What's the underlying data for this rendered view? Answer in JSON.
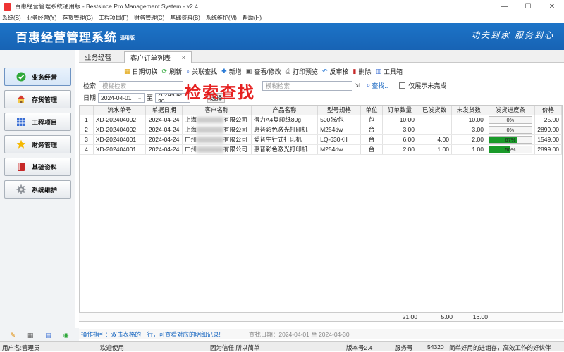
{
  "window": {
    "title": "百惠经营管理系统通用版 - Bestsince Pro Management System - v2.4",
    "min": "—",
    "max": "☐",
    "close": "✕"
  },
  "menu": [
    "系统(S)",
    "业务经营(Y)",
    "存货管理(G)",
    "工程项目(F)",
    "财务管理(C)",
    "基础资料(B)",
    "系统维护(M)",
    "帮助(H)"
  ],
  "banner": {
    "brand": "百惠经营管理系统",
    "edition": "通用版",
    "slogan": "功夫到家 服务到心"
  },
  "sidebar": [
    {
      "label": "业务经营",
      "icon": "check-icon"
    },
    {
      "label": "存货管理",
      "icon": "house-icon"
    },
    {
      "label": "工程项目",
      "icon": "grid-icon"
    },
    {
      "label": "财务管理",
      "icon": "star-icon"
    },
    {
      "label": "基础资料",
      "icon": "book-icon"
    },
    {
      "label": "系统维护",
      "icon": "gear-icon"
    }
  ],
  "tabs": [
    {
      "label": "业务经营"
    },
    {
      "label": "客户订单列表",
      "close": "×"
    }
  ],
  "toolbar": [
    "日期切换",
    "刷新",
    "关联查找",
    "新增",
    "查看/修改",
    "打印预览",
    "反审核",
    "删除",
    "工具箱"
  ],
  "filter": {
    "search_label": "检索",
    "search_placeholder": "模糊检索",
    "search_placeholder2": "模糊检索",
    "search_btn": "查找..",
    "incomplete_label": "仅展示未完成",
    "date_label": "日期",
    "date_from": "2024-04-01",
    "to_label": "至",
    "date_to": "2024-04-30",
    "choose_btn": "选择"
  },
  "overlay_text": "检索查找",
  "table": {
    "headers": [
      "",
      "流水单号",
      "单据日期",
      "客户名称",
      "产品名称",
      "型号规格",
      "单位",
      "订单数量",
      "已发货数",
      "未发货数",
      "发货进度条",
      "价格"
    ],
    "rows": [
      {
        "idx": "1",
        "no": "XD-202404002",
        "date": "2024-04-24",
        "cust_a": "上海",
        "cust_b": "有限公司",
        "product": "得力A4复印纸80g",
        "spec": "500张/包",
        "unit": "包",
        "qty": "10.00",
        "shipped": "",
        "pending": "10.00",
        "progress": 0,
        "progress_label": "0%",
        "price": "25.00"
      },
      {
        "idx": "2",
        "no": "XD-202404002",
        "date": "2024-04-24",
        "cust_a": "上海",
        "cust_b": "有限公司",
        "product": "惠普彩色激光打印机",
        "spec": "M254dw",
        "unit": "台",
        "qty": "3.00",
        "shipped": "",
        "pending": "3.00",
        "progress": 0,
        "progress_label": "0%",
        "price": "2899.00"
      },
      {
        "idx": "3",
        "no": "XD-202404001",
        "date": "2024-04-24",
        "cust_a": "广州",
        "cust_b": "有限公司",
        "product": "爱普生针式打印机",
        "spec": "LQ-630KII",
        "unit": "台",
        "qty": "6.00",
        "shipped": "4.00",
        "pending": "2.00",
        "progress": 67,
        "progress_label": "67%",
        "price": "1549.00"
      },
      {
        "idx": "4",
        "no": "XD-202404001",
        "date": "2024-04-24",
        "cust_a": "广州",
        "cust_b": "有限公司",
        "product": "惠普彩色激光打印机",
        "spec": "M254dw",
        "unit": "台",
        "qty": "2.00",
        "shipped": "1.00",
        "pending": "1.00",
        "progress": 50,
        "progress_label": "50%",
        "price": "2899.00"
      }
    ],
    "totals": {
      "qty": "21.00",
      "shipped": "5.00",
      "pending": "16.00"
    }
  },
  "hint": {
    "text": "操作指引：双击表格的一行，可查看对应的明细记录!",
    "query": "查找日期：2024-04-01 至 2024-04-30"
  },
  "status": {
    "user": "用户名:管理员",
    "welcome": "欢迎使用",
    "motto": "因为信任 所以简单",
    "version": "版本号2.4",
    "service": "服务号",
    "service_no": "54320",
    "tagline": "简单好用的进销存，高效工作的好伙伴"
  },
  "colors": {
    "banner": "#1763b4",
    "progress": "#1a9a2a",
    "overlay": "#e62020"
  }
}
